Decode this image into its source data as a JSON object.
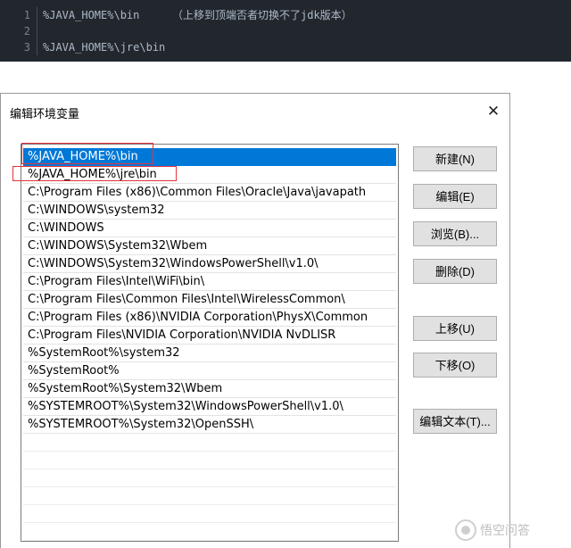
{
  "code": {
    "lines": [
      {
        "num": "1",
        "text": "%JAVA_HOME%\\bin",
        "comment": "（上移到顶端否者切换不了jdk版本）"
      },
      {
        "num": "2",
        "text": "",
        "comment": ""
      },
      {
        "num": "3",
        "text": "%JAVA_HOME%\\jre\\bin",
        "comment": ""
      }
    ]
  },
  "dialog": {
    "title": "编辑环境变量",
    "close_label": "✕",
    "paths": [
      "%JAVA_HOME%\\bin",
      "%JAVA_HOME%\\jre\\bin",
      "C:\\Program Files (x86)\\Common Files\\Oracle\\Java\\javapath",
      "C:\\WINDOWS\\system32",
      "C:\\WINDOWS",
      "C:\\WINDOWS\\System32\\Wbem",
      "C:\\WINDOWS\\System32\\WindowsPowerShell\\v1.0\\",
      "C:\\Program Files\\Intel\\WiFi\\bin\\",
      "C:\\Program Files\\Common Files\\Intel\\WirelessCommon\\",
      "C:\\Program Files (x86)\\NVIDIA Corporation\\PhysX\\Common",
      "C:\\Program Files\\NVIDIA Corporation\\NVIDIA NvDLISR",
      "%SystemRoot%\\system32",
      "%SystemRoot%",
      "%SystemRoot%\\System32\\Wbem",
      "%SYSTEMROOT%\\System32\\WindowsPowerShell\\v1.0\\",
      "%SYSTEMROOT%\\System32\\OpenSSH\\"
    ],
    "selected_index": 0,
    "buttons": {
      "new": "新建(N)",
      "edit": "编辑(E)",
      "browse": "浏览(B)...",
      "delete": "删除(D)",
      "move_up": "上移(U)",
      "move_down": "下移(O)",
      "edit_text": "编辑文本(T)..."
    },
    "colors": {
      "selection": "#0078d7",
      "annotation": "#e5323c"
    }
  },
  "watermark": {
    "text": "悟空问答"
  }
}
